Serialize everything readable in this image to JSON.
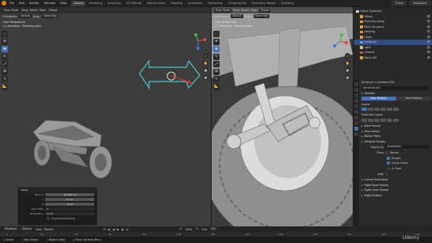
{
  "menubar": {
    "menus": [
      "File",
      "Edit",
      "Render",
      "Window",
      "Help"
    ],
    "tabs": [
      "Layout",
      "Modeling",
      "Sculpting",
      "UV Editing",
      "Texture Paint",
      "Shading",
      "Animation",
      "Rendering",
      "Compositing",
      "Geometry Nodes",
      "Scripting"
    ],
    "active_tab": "Layout",
    "scene_label": "Scene",
    "view_layer_label": "ViewLayer"
  },
  "left_viewport": {
    "header": {
      "mode": "Pose Mode",
      "view": "View",
      "select": "Select",
      "pose": "Pose",
      "transform": "Global"
    },
    "header2": {
      "orientation": "Orientation:",
      "orientation_value": "Default",
      "drag": "Drag:",
      "drag_value": "Select Box"
    },
    "label_line1": "User Perspective",
    "label_line2": "(1) Armature : Steering point",
    "accent_color": "#4fc3c9",
    "arrow_color": "#d63333"
  },
  "right_viewport": {
    "header": {
      "mode": "Pose Mode",
      "view": "View",
      "select": "Select",
      "pose": "Pose",
      "transform": "Global"
    },
    "header2": {
      "orientation": "Orientation:",
      "orientation_value": "Default",
      "drag": "Drag:",
      "drag_value": "Select Box"
    },
    "label_line1": "User Perspective",
    "label_line2": "(1) Armature : Steering point"
  },
  "operator_panel": {
    "title": "Move",
    "rows": [
      {
        "label": "Move X",
        "value": "-21.987 cm"
      },
      {
        "label": "Y",
        "value": "0 cm"
      },
      {
        "label": "Z",
        "value": "-0 cm"
      },
      {
        "label": "Axis Ortho",
        "value": "X"
      },
      {
        "label": "Orientation",
        "value": "Local"
      }
    ],
    "proportional_label": "Proportional Editing"
  },
  "outliner": {
    "items": [
      {
        "label": "Scene Collection",
        "color": "#cfcfcf",
        "indent": 0,
        "selected": false
      },
      {
        "label": "Wheel",
        "color": "#e0a040",
        "indent": 1,
        "selected": false
      },
      {
        "label": "Front the group",
        "color": "#e0a040",
        "indent": 1,
        "selected": false
      },
      {
        "label": "Back the group",
        "color": "#e0a040",
        "indent": 1,
        "selected": false
      },
      {
        "label": "Steering",
        "color": "#e0a040",
        "indent": 1,
        "selected": false
      },
      {
        "label": "Chain",
        "color": "#e0a040",
        "indent": 1,
        "selected": false
      },
      {
        "label": "Armature",
        "color": "#5aa0e0",
        "indent": 1,
        "selected": true
      },
      {
        "label": "Light",
        "color": "#e0c060",
        "indent": 1,
        "selected": false
      },
      {
        "label": "Camera",
        "color": "#c05050",
        "indent": 1,
        "selected": false
      },
      {
        "label": "Plane.007",
        "color": "#e0a040",
        "indent": 1,
        "selected": false
      }
    ]
  },
  "properties": {
    "breadcrumb": "Armature  >  Armature.001",
    "data_name": "Armature.001",
    "sections": {
      "skeleton": "Skeleton",
      "pose_position": "Pose Position",
      "rest_position": "Rest Position",
      "layers": "Layers",
      "protected_layers": "Protected Layers",
      "bone_groups": "Bone Groups",
      "pose_library": "Pose Library",
      "motion_paths": "Motion Paths",
      "viewport_display": "Viewport Display",
      "display_as": "Display As",
      "display_as_value": "Octahedral",
      "show": "Show",
      "names": "Names",
      "shapes": "Shapes",
      "group_colors": "Group Colors",
      "in_front": "In Front",
      "axes": "Axes",
      "inverse_kinematics": "Inverse Kinematics",
      "rigify_bone_groups": "Rigify Bone Groups",
      "rigify_layer_names": "Rigify Layer Names",
      "rigify_buttons": "Rigify Buttons"
    }
  },
  "timeline": {
    "playback": "Playback",
    "keying": "Keying",
    "view": "View",
    "marker": "Marker",
    "frame": "1",
    "start_label": "Start",
    "start": "1",
    "end_label": "End",
    "end": "250",
    "ruler": [
      "0",
      "20",
      "40",
      "60",
      "80",
      "100",
      "120",
      "140",
      "160",
      "180",
      "200",
      "220",
      "240"
    ]
  },
  "statusbar": {
    "items": [
      "Select",
      "Box Select",
      "Rotate View",
      "Pose Context Menu"
    ]
  },
  "watermark": "Udemy"
}
